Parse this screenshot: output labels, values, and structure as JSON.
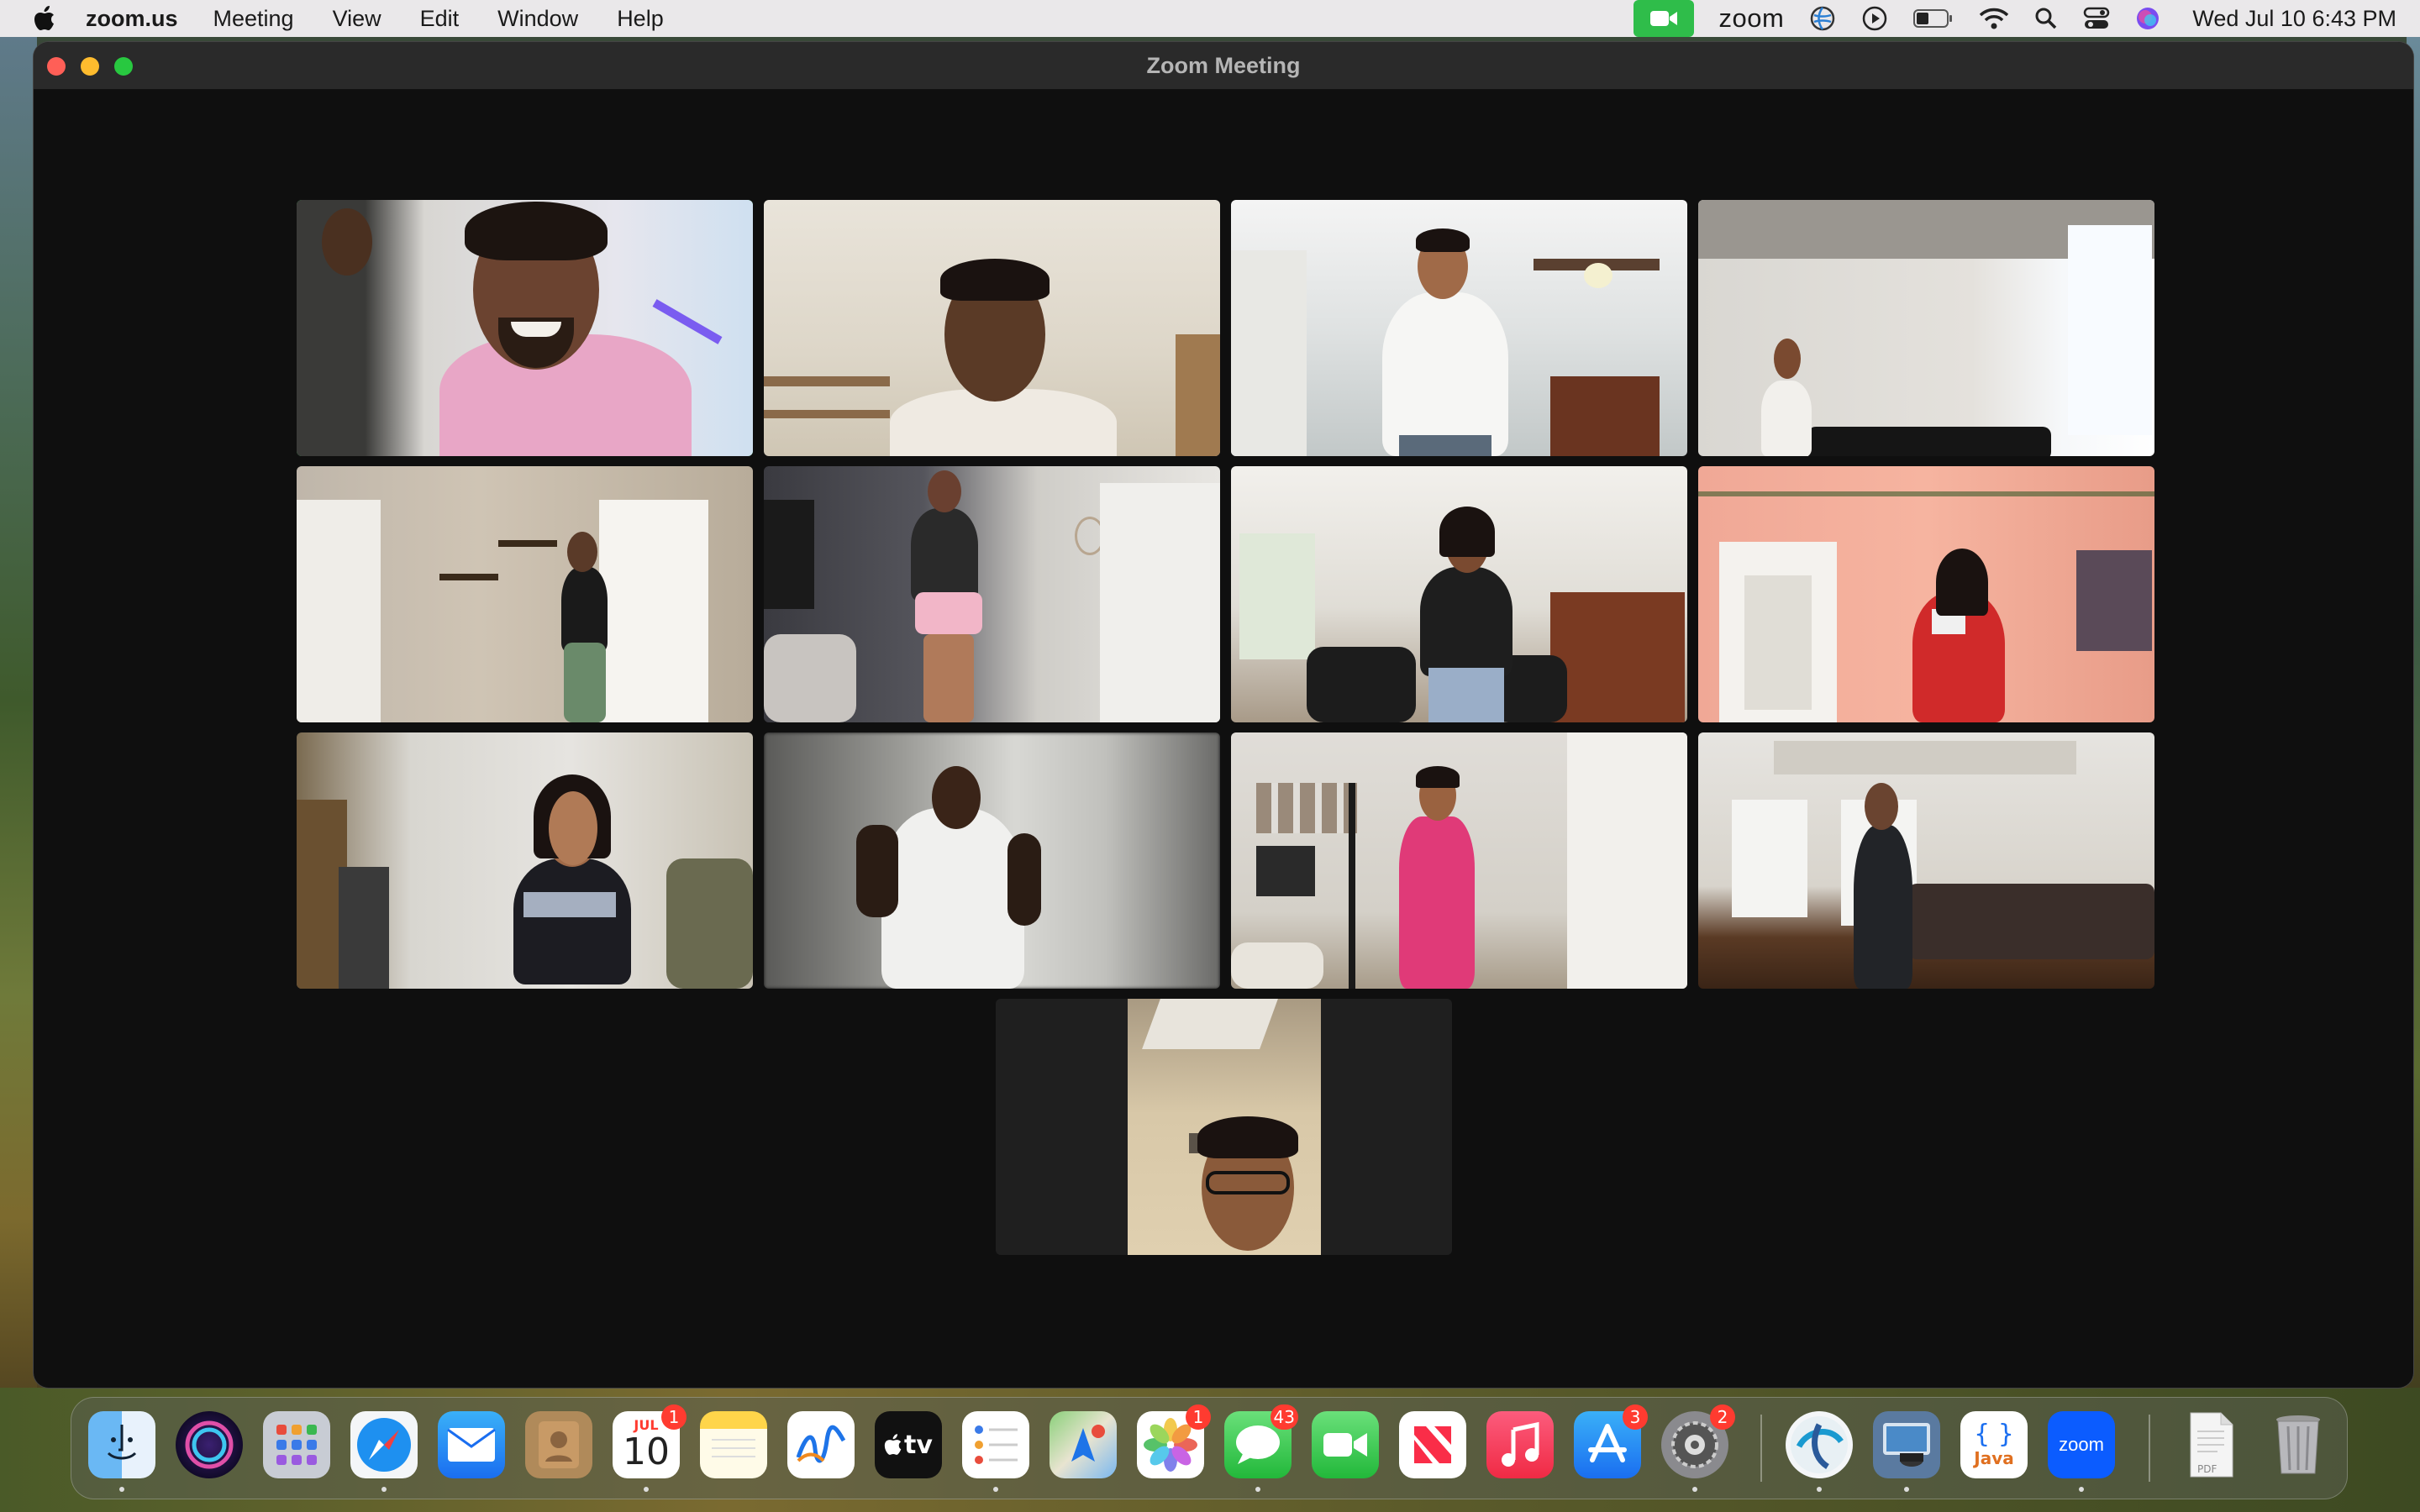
{
  "menubar": {
    "app_name": "zoom.us",
    "menus": [
      "Meeting",
      "View",
      "Edit",
      "Window",
      "Help"
    ],
    "zoom_label": "zoom",
    "clock": "Wed Jul 10  6:43 PM"
  },
  "window": {
    "title": "Zoom Meeting"
  },
  "dock": {
    "calendar_month": "JUL",
    "calendar_day": "10",
    "tv_label": "tv",
    "zoom_label": "zoom",
    "java_label": "Java",
    "pdf_label": "PDF",
    "badges": {
      "calendar": "1",
      "photos": "1",
      "messages": "43",
      "app_store": "3",
      "settings": "2"
    }
  },
  "colors": {
    "active_speaker": "#2ed158",
    "zoom_blue": "#0b5cff",
    "badge_red": "#ff3b30"
  }
}
